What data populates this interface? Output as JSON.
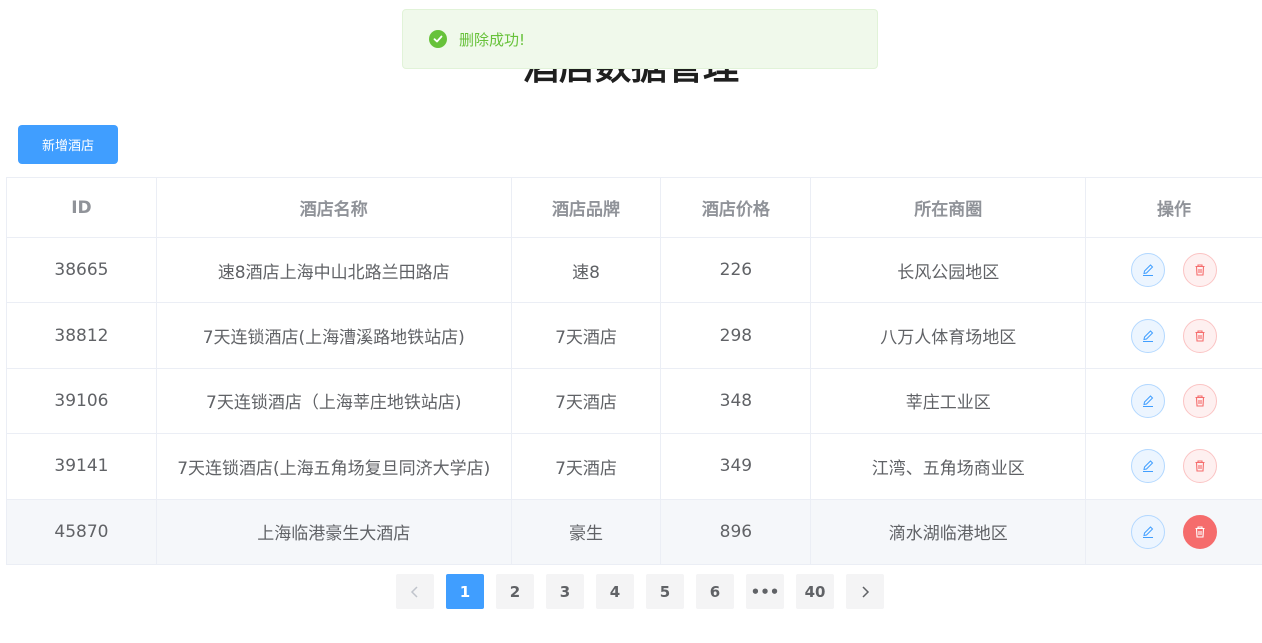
{
  "page": {
    "title": "酒店数据管理"
  },
  "toast": {
    "message": "删除成功!",
    "icon": "check-circle-icon",
    "color": "#67c23a"
  },
  "toolbar": {
    "add_label": "新增酒店",
    "accent": "#409eff"
  },
  "table": {
    "columns": [
      "ID",
      "酒店名称",
      "酒店品牌",
      "酒店价格",
      "所在商圈",
      "操作"
    ],
    "rows": [
      {
        "id": "38665",
        "name": "速8酒店上海中山北路兰田路店",
        "brand": "速8",
        "price": "226",
        "business": "长风公园地区"
      },
      {
        "id": "38812",
        "name": "7天连锁酒店(上海漕溪路地铁站店)",
        "brand": "7天酒店",
        "price": "298",
        "business": "八万人体育场地区"
      },
      {
        "id": "39106",
        "name": "7天连锁酒店（上海莘庄地铁站店)",
        "brand": "7天酒店",
        "price": "348",
        "business": "莘庄工业区"
      },
      {
        "id": "39141",
        "name": "7天连锁酒店(上海五角场复旦同济大学店)",
        "brand": "7天酒店",
        "price": "349",
        "business": "江湾、五角场商业区"
      },
      {
        "id": "45870",
        "name": "上海临港豪生大酒店",
        "brand": "豪生",
        "price": "896",
        "business": "滴水湖临港地区"
      }
    ]
  },
  "pagination": {
    "prev_icon": "chevron-left-icon",
    "next_icon": "chevron-right-icon",
    "pages": [
      "1",
      "2",
      "3",
      "4",
      "5",
      "6",
      "•••",
      "40"
    ],
    "current": "1"
  }
}
